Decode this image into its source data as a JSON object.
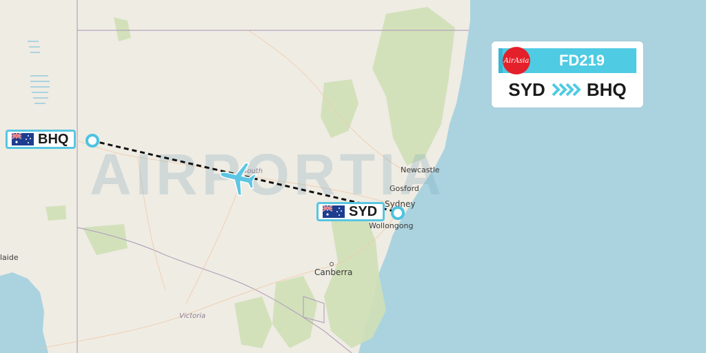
{
  "watermark": "AIRPORTIA",
  "flight": {
    "number": "FD219",
    "airline_logo_text": "AirAsia",
    "origin_code": "SYD",
    "destination_code": "BHQ",
    "route_arrow_icon": "chevron-arrows-icon"
  },
  "airports": {
    "origin": {
      "code": "SYD",
      "flag_icon": "australia-flag-icon"
    },
    "destination": {
      "code": "BHQ",
      "flag_icon": "australia-flag-icon"
    }
  },
  "cities": {
    "newcastle": "Newcastle",
    "gosford": "Gosford",
    "sydney": "Sydney",
    "wollongong": "Wollongong",
    "canberra": "Canberra",
    "adelaide": "laide"
  },
  "regions": {
    "nsw": "South",
    "victoria": "Victoria"
  },
  "colors": {
    "ocean": "#aad3df",
    "land": "#efece4",
    "forest": "#cfe0b6",
    "accent": "#4fcbe3",
    "airasia_red": "#e4202a",
    "route_line": "#111111",
    "plane": "#5cc6e3"
  }
}
